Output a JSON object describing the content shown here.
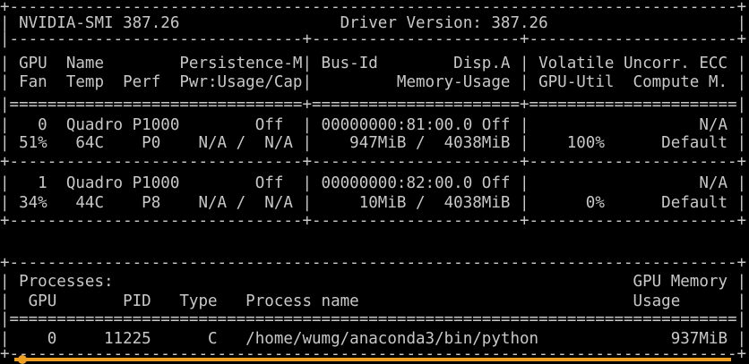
{
  "terminal": {
    "lines": [
      "+-----------------------------------------------------------------------------+",
      "| NVIDIA-SMI 387.26                 Driver Version: 387.26                    |",
      "|-------------------------------+----------------------+----------------------+",
      "| GPU  Name        Persistence-M| Bus-Id        Disp.A | Volatile Uncorr. ECC |",
      "| Fan  Temp  Perf  Pwr:Usage/Cap|         Memory-Usage | GPU-Util  Compute M. |",
      "|===============================+======================+======================|",
      "|   0  Quadro P1000        Off  | 00000000:81:00.0 Off |                  N/A |",
      "| 51%   64C    P0    N/A /  N/A |    947MiB /  4038MiB |    100%      Default |",
      "+-------------------------------+----------------------+----------------------+",
      "|   1  Quadro P1000        Off  | 00000000:82:00.0 Off |                  N/A |",
      "| 34%   44C    P8    N/A /  N/A |     10MiB /  4038MiB |      0%      Default |",
      "+-------------------------------+----------------------+----------------------+",
      "",
      "",
      "+-----------------------------------------------------------------------------+",
      "| Processes:                                                       GPU Memory |",
      "|  GPU       PID   Type   Process name                             Usage      |",
      "|=============================================================================|",
      "|    0     11225      C   /home/wumg/anaconda3/bin/python              937MiB |",
      "+-----------------------------------------------------------------------------+"
    ]
  },
  "colors": {
    "background": "#000000",
    "text": "#c8c8c8",
    "marker": "#f0a020"
  }
}
